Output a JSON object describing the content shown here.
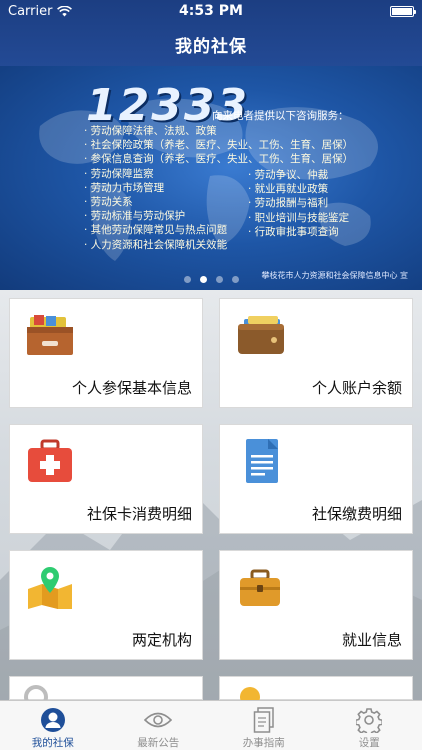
{
  "status": {
    "carrier": "Carrier",
    "time": "4:53 PM"
  },
  "nav": {
    "title": "我的社保"
  },
  "banner": {
    "hotline": "12333",
    "intro": "向来电者提供以下咨询服务：",
    "left_items": [
      "· 劳动保障法律、法规、政策",
      "· 社会保险政策（养老、医疗、失业、工伤、生育、居保）",
      "· 参保信息查询（养老、医疗、失业、工伤、生育、居保）",
      "· 劳动保障监察",
      "· 劳动力市场管理",
      "· 劳动关系",
      "· 劳动标准与劳动保护",
      "· 其他劳动保障常见与热点问题",
      "· 人力资源和社会保障机关效能"
    ],
    "right_items": [
      "· 劳动争议、仲裁",
      "· 就业再就业政策",
      "· 劳动报酬与福利",
      "· 职业培训与技能鉴定",
      "· 行政审批事项查询"
    ],
    "credit": "攀枝花市人力资源和社会保障信息中心 宣",
    "page_count": 4,
    "active_page": 1
  },
  "tiles": [
    {
      "label": "个人参保基本信息",
      "icon": "drawer-icon"
    },
    {
      "label": "个人账户余额",
      "icon": "wallet-icon"
    },
    {
      "label": "社保卡消费明细",
      "icon": "first-aid-kit-icon"
    },
    {
      "label": "社保缴费明细",
      "icon": "document-icon"
    },
    {
      "label": "两定机构",
      "icon": "map-pin-icon"
    },
    {
      "label": "就业信息",
      "icon": "briefcase-icon"
    }
  ],
  "tabs": [
    {
      "label": "我的社保",
      "icon": "person-icon",
      "active": true
    },
    {
      "label": "最新公告",
      "icon": "eye-icon",
      "active": false
    },
    {
      "label": "办事指南",
      "icon": "documents-icon",
      "active": false
    },
    {
      "label": "设置",
      "icon": "gear-icon",
      "active": false
    }
  ],
  "colors": {
    "nav": "#234a95",
    "tab_active": "#1f4f99",
    "tab_inactive": "#8e8e8e"
  }
}
